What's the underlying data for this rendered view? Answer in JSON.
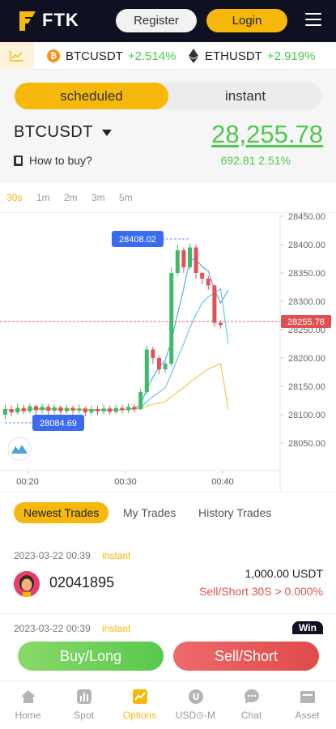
{
  "header": {
    "logo_text": "FTK",
    "register_label": "Register",
    "login_label": "Login"
  },
  "ticker": {
    "items": [
      {
        "symbol": "BTCUSDT",
        "change": "+2.514%",
        "icon": "bitcoin-icon"
      },
      {
        "symbol": "ETHUSDT",
        "change": "+2.919%",
        "icon": "ethereum-icon"
      }
    ]
  },
  "mode": {
    "tabs": [
      {
        "label": "scheduled",
        "active": true
      },
      {
        "label": "instant",
        "active": false
      }
    ]
  },
  "pair": {
    "name": "BTCUSDT",
    "how_to_buy": "How to buy?",
    "price": "28,255.78",
    "change": "692.81 2.51%"
  },
  "timeframes": [
    {
      "label": "30s",
      "active": true
    },
    {
      "label": "1m",
      "active": false
    },
    {
      "label": "2m",
      "active": false
    },
    {
      "label": "3m",
      "active": false
    },
    {
      "label": "5m",
      "active": false
    }
  ],
  "chart_data": {
    "type": "candlestick",
    "y_ticks": [
      "28450.00",
      "28400.00",
      "28350.00",
      "28300.00",
      "28250.00",
      "28200.00",
      "28150.00",
      "28100.00",
      "28050.00"
    ],
    "x_ticks": [
      "00:20",
      "00:30",
      "00:40"
    ],
    "ylim": [
      28030,
      28450
    ],
    "current_price": "28255.78",
    "high_label": "28408.02",
    "low_label": "28084.69",
    "candles": [
      [
        28100,
        28110,
        28092,
        28118
      ],
      [
        28110,
        28104,
        28098,
        28116
      ],
      [
        28104,
        28112,
        28100,
        28120
      ],
      [
        28112,
        28106,
        28101,
        28118
      ],
      [
        28106,
        28115,
        28102,
        28120
      ],
      [
        28115,
        28108,
        28100,
        28118
      ],
      [
        28108,
        28114,
        28102,
        28120
      ],
      [
        28114,
        28107,
        28100,
        28119
      ],
      [
        28107,
        28113,
        28101,
        28118
      ],
      [
        28113,
        28106,
        28099,
        28117
      ],
      [
        28106,
        28112,
        28102,
        28118
      ],
      [
        28112,
        28107,
        28100,
        28116
      ],
      [
        28107,
        28111,
        28101,
        28118
      ],
      [
        28111,
        28104,
        28097,
        28115
      ],
      [
        28104,
        28110,
        28099,
        28116
      ],
      [
        28110,
        28106,
        28099,
        28116
      ],
      [
        28106,
        28111,
        28100,
        28118
      ],
      [
        28111,
        28105,
        28099,
        28116
      ],
      [
        28105,
        28112,
        28101,
        28118
      ],
      [
        28112,
        28108,
        28102,
        28117
      ],
      [
        28108,
        28114,
        28103,
        28120
      ],
      [
        28114,
        28110,
        28104,
        28119
      ],
      [
        28110,
        28140,
        28108,
        28145
      ],
      [
        28140,
        28215,
        28135,
        28222
      ],
      [
        28215,
        28200,
        28190,
        28220
      ],
      [
        28200,
        28180,
        28172,
        28205
      ],
      [
        28180,
        28190,
        28174,
        28194
      ],
      [
        28190,
        28350,
        28185,
        28360
      ],
      [
        28350,
        28390,
        28345,
        28400
      ],
      [
        28390,
        28360,
        28350,
        28395
      ],
      [
        28360,
        28395,
        28355,
        28402
      ],
      [
        28395,
        28350,
        28340,
        28400
      ],
      [
        28350,
        28340,
        28330,
        28352
      ],
      [
        28340,
        28328,
        28320,
        28345
      ],
      [
        28328,
        28262,
        28255,
        28330
      ],
      [
        28262,
        28258,
        28252,
        28266
      ]
    ]
  },
  "trade_tabs": [
    {
      "label": "Newest Trades",
      "active": true
    },
    {
      "label": "My Trades",
      "active": false
    },
    {
      "label": "History Trades",
      "active": false
    }
  ],
  "trades": [
    {
      "date": "2023-03-22 00:39",
      "type": "instant",
      "id": "02041895",
      "amount": "1,000.00 USDT",
      "result": "Sell/Short 30S > 0.000%"
    },
    {
      "date": "2023-03-22 00:39",
      "type": "instant",
      "badge": "Win"
    }
  ],
  "actions": {
    "buy_label": "Buy/Long",
    "sell_label": "Sell/Short"
  },
  "nav": [
    {
      "label": "Home",
      "icon": "home-icon",
      "active": false
    },
    {
      "label": "Spot",
      "icon": "spot-icon",
      "active": false
    },
    {
      "label": "Options",
      "icon": "options-icon",
      "active": true
    },
    {
      "label": "USD⊙-M",
      "icon": "usd-m-icon",
      "active": false
    },
    {
      "label": "Chat",
      "icon": "chat-icon",
      "active": false
    },
    {
      "label": "Asset",
      "icon": "wallet-icon",
      "active": false
    }
  ],
  "colors": {
    "accent": "#f5b80b",
    "up": "#4cc94c",
    "down": "#e05050",
    "header_bg": "#0f1022"
  }
}
